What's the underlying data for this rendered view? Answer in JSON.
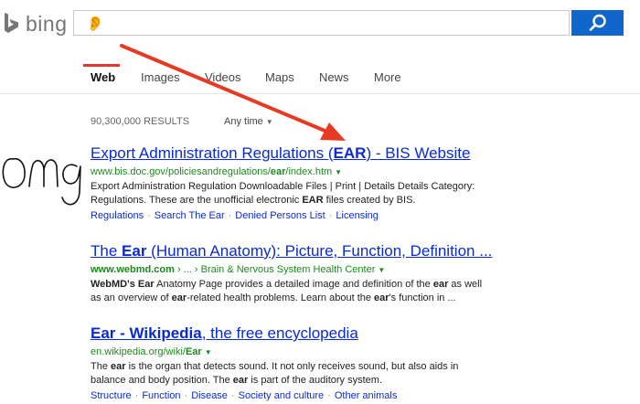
{
  "header": {
    "logo_text": "bing",
    "search_value": "👂",
    "search_button_label": "search"
  },
  "tabs": [
    {
      "label": "Web",
      "active": true
    },
    {
      "label": "Images",
      "active": false
    },
    {
      "label": "Videos",
      "active": false
    },
    {
      "label": "Maps",
      "active": false
    },
    {
      "label": "News",
      "active": false
    },
    {
      "label": "More",
      "active": false
    }
  ],
  "results_meta": {
    "count": "90,300,000 RESULTS",
    "filter_label": "Any time"
  },
  "results": [
    {
      "title_pre": "Export Administration Regulations (",
      "title_bold": "EAR",
      "title_post": ") - BIS Website",
      "cite_pre": "www.bis.doc.gov/policiesandregulations/",
      "cite_bold": "ear",
      "cite_post": "/index.htm",
      "snippet_line1": "Export Administration Regulation Downloadable Files | Print | Details Details Category:",
      "snippet_line2_pre": "Regulations. These are the unofficial electronic ",
      "snippet_line2_bold": "EAR",
      "snippet_line2_post": " files created by BIS.",
      "links": [
        "Regulations",
        "Search The Ear",
        "Denied Persons List",
        "Licensing"
      ]
    },
    {
      "title_pre": "The ",
      "title_bold": "Ear",
      "title_post": " (Human Anatomy): Picture, Function, Definition ...",
      "cite_pre": "www.webmd.com",
      "cite_post": " › ... › Brain & Nervous System Health Center",
      "snippet_a": "WebMD's",
      "snippet_b": " Ear",
      "snippet_c": " Anatomy Page provides a detailed image and definition of the ",
      "snippet_d": "ear",
      "snippet_e": " as well",
      "snippet2_a": "as an overview of ",
      "snippet2_b": "ear",
      "snippet2_c": "-related health problems. Learn about the ",
      "snippet2_d": "ear",
      "snippet2_e": "'s function in ..."
    },
    {
      "title_bold": "Ear - Wikipedia",
      "title_post": ", the free encyclopedia",
      "cite_pre": "en.wikipedia.org",
      "cite_mid": "/wiki/",
      "cite_bold": "Ear",
      "snippet1_a": "The ",
      "snippet1_b": "ear",
      "snippet1_c": " is the organ that detects sound. It not only receives sound, but also aids in",
      "snippet2_a": "balance and body position. The ",
      "snippet2_b": "ear",
      "snippet2_c": " is part of the auditory system.",
      "links": [
        "Structure",
        "Function",
        "Disease",
        "Society and culture",
        "Other animals"
      ]
    }
  ],
  "annotation": {
    "handwriting": "omg",
    "arrow_color": "#e63a22"
  }
}
